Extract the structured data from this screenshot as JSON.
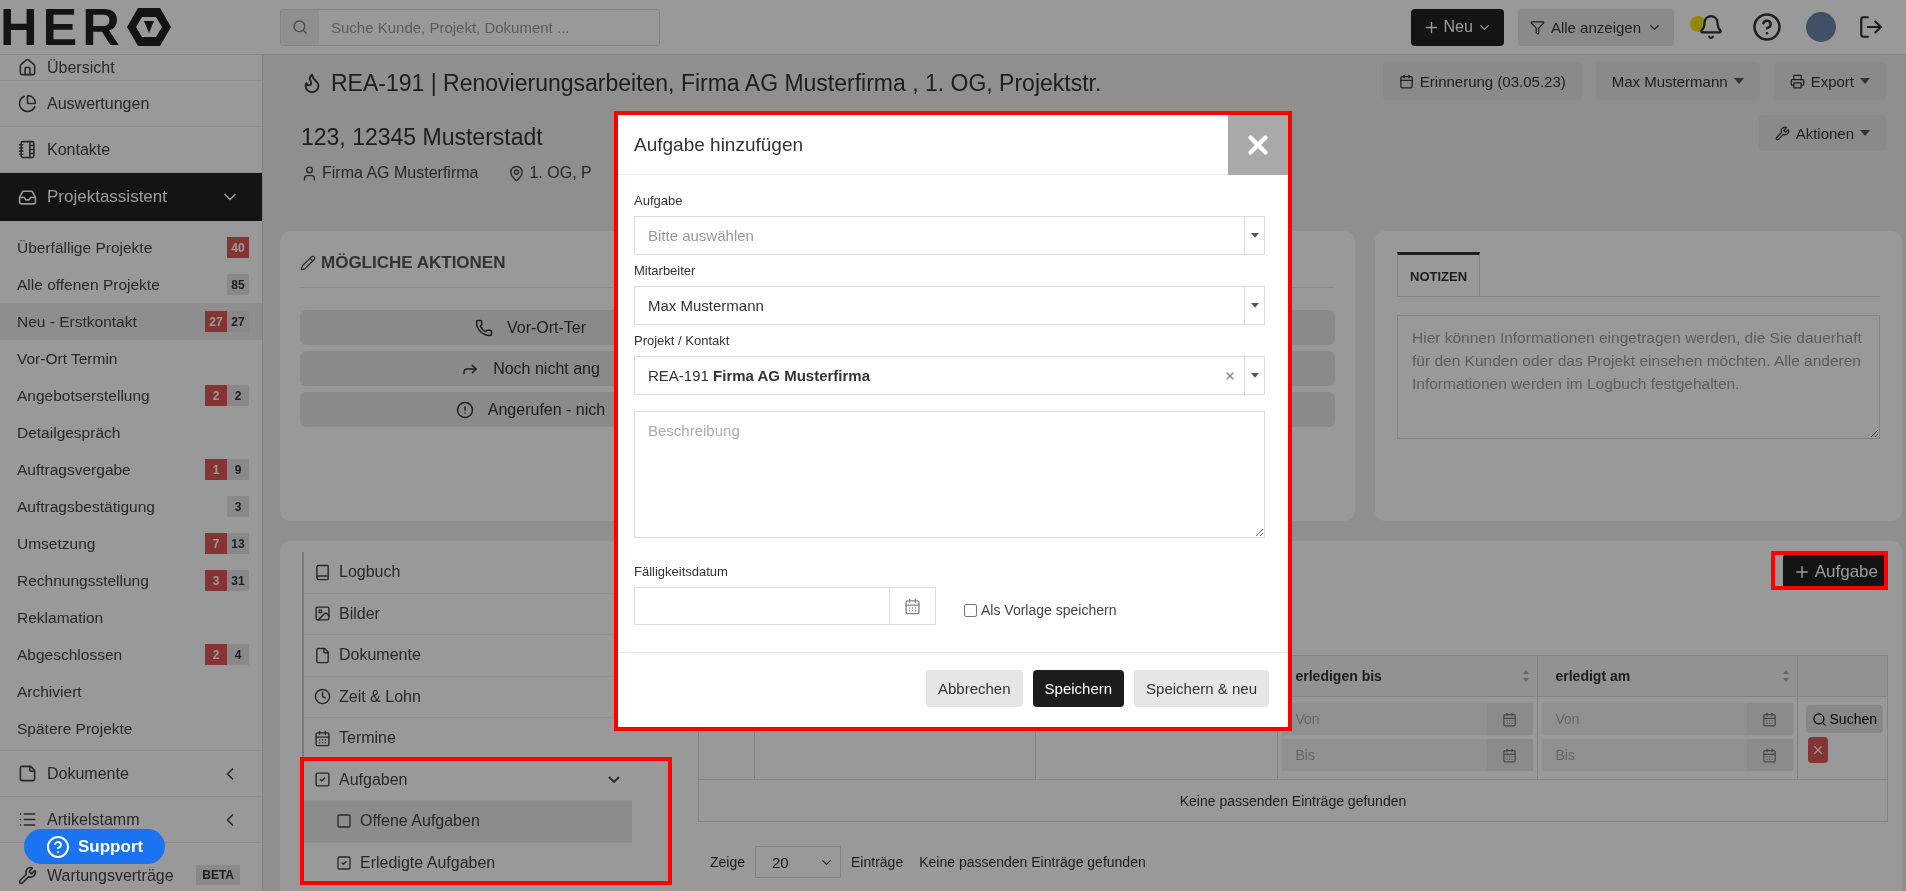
{
  "logo": {
    "text": "HER"
  },
  "search": {
    "placeholder": "Suche Kunde, Projekt, Dokument ..."
  },
  "header": {
    "new_button": "Neu",
    "filter_button": "Alle anzeigen"
  },
  "sidebar": {
    "top_items": [
      {
        "label": "Übersicht"
      },
      {
        "label": "Auswertungen"
      },
      {
        "label": "Kontakte"
      }
    ],
    "section": {
      "label": "Projektassistent",
      "expanded": true,
      "children": [
        {
          "label": "Überfällige Projekte",
          "alert_count": "40",
          "selected": false
        },
        {
          "label": "Alle offenen Projekte",
          "count": "85",
          "selected": false
        },
        {
          "label": "Neu - Erstkontakt",
          "alert_count": "27",
          "count": "27",
          "selected": true
        },
        {
          "label": "Vor-Ort Termin",
          "selected": false
        },
        {
          "label": "Angebotserstellung",
          "alert_count": "2",
          "count": "2",
          "selected": false
        },
        {
          "label": "Detailgespräch",
          "selected": false
        },
        {
          "label": "Auftragsvergabe",
          "alert_count": "1",
          "count": "9",
          "selected": false
        },
        {
          "label": "Auftragsbestätigung",
          "count": "3",
          "selected": false
        },
        {
          "label": "Umsetzung",
          "alert_count": "7",
          "count": "13",
          "selected": false
        },
        {
          "label": "Rechnungsstellung",
          "alert_count": "3",
          "count": "31",
          "selected": false
        },
        {
          "label": "Reklamation",
          "selected": false
        },
        {
          "label": "Abgeschlossen",
          "alert_count": "2",
          "count": "4",
          "selected": false
        },
        {
          "label": "Archiviert",
          "selected": false
        },
        {
          "label": "Spätere Projekte",
          "selected": false
        }
      ]
    },
    "bottom_items": [
      {
        "label": "Dokumente",
        "expanded": false
      },
      {
        "label": "Artikelstamm",
        "expanded": false
      },
      {
        "label": "Wartungsverträge",
        "badge": "BETA"
      }
    ]
  },
  "support_button": "Support",
  "project": {
    "title_lines": [
      "REA-191 | Renovierungsarbeiten, Firma AG Musterfirma , 1. OG, Projektstr.",
      "123, 12345 Musterstadt"
    ],
    "customer": "Firma AG Musterfirma",
    "location": "1. OG, P"
  },
  "project_actions": [
    {
      "label": "Erinnerung (03.05.23)",
      "has_menu": false
    },
    {
      "label": "Max Mustermann",
      "has_menu": true
    },
    {
      "label": "Export",
      "has_menu": true
    },
    {
      "label": "Aktionen",
      "has_menu": true
    }
  ],
  "actions_card": {
    "title": "MÖGLICHE AKTIONEN",
    "buttons": [
      "Vor-Ort-Ter",
      "Noch nicht ang",
      "Angerufen - nich"
    ]
  },
  "notes": {
    "tab": "NOTIZEN",
    "placeholder": "Hier können Informationen eingetragen werden, die Sie dauerhaft für den Kunden oder das Projekt einsehen möchten. Alle anderen Informationen werden im Logbuch festgehalten."
  },
  "sections": [
    {
      "label": "Logbuch",
      "selected": false
    },
    {
      "label": "Bilder",
      "selected": false
    },
    {
      "label": "Dokumente",
      "selected": false
    },
    {
      "label": "Zeit & Lohn",
      "selected": false
    },
    {
      "label": "Termine",
      "selected": false
    },
    {
      "label": "Aufgaben",
      "selected": false,
      "expanded": true,
      "children": [
        {
          "label": "Offene Aufgaben",
          "selected": true
        },
        {
          "label": "Erledigte Aufgaben",
          "selected": false
        }
      ]
    }
  ],
  "add_task_button": "Aufgabe",
  "table": {
    "columns": [
      {
        "label": "erledigen bis",
        "filters": [
          {
            "placeholder": "Von"
          },
          {
            "placeholder": "Bis"
          }
        ]
      },
      {
        "label": "erledigt am",
        "filters": [
          {
            "placeholder": "Von"
          },
          {
            "placeholder": "Bis"
          }
        ]
      }
    ],
    "search_button": "Suchen",
    "empty_message": "Keine passenden Einträge gefunden"
  },
  "pagination": {
    "prefix": "Zeige",
    "page_size": "20",
    "suffix": "Einträge",
    "info": "Keine passenden Einträge gefunden"
  },
  "modal": {
    "title": "Aufgabe hinzufügen",
    "fields": [
      {
        "kind": "select",
        "label": "Aufgabe",
        "placeholder": "Bitte auswählen"
      },
      {
        "kind": "select",
        "label": "Mitarbeiter",
        "value": "Max Mustermann"
      },
      {
        "kind": "select",
        "label": "Projekt / Kontakt",
        "value": "REA-191 **Firma AG Musterfirma**",
        "clearable": true
      },
      {
        "kind": "textarea",
        "placeholder": "Beschreibung"
      },
      {
        "kind": "date",
        "label": "Fälligkeitsdatum"
      }
    ],
    "checkbox": {
      "label": "Als Vorlage speichern",
      "checked": false
    },
    "buttons": [
      {
        "label": "Abbrechen",
        "kind": "secondary"
      },
      {
        "label": "Speichern",
        "kind": "primary"
      },
      {
        "label": "Speichern & neu",
        "kind": "secondary"
      }
    ]
  }
}
